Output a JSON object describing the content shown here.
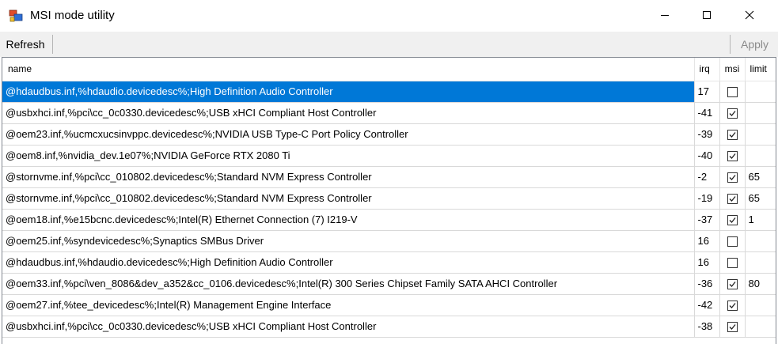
{
  "window": {
    "title": "MSI mode utility"
  },
  "toolbar": {
    "refresh_label": "Refresh",
    "apply_label": "Apply"
  },
  "table": {
    "columns": [
      "name",
      "irq",
      "msi",
      "limit"
    ],
    "rows": [
      {
        "name": "@hdaudbus.inf,%hdaudio.devicedesc%;High Definition Audio Controller",
        "irq": "17",
        "msi": false,
        "limit": ""
      },
      {
        "name": "@usbxhci.inf,%pci\\cc_0c0330.devicedesc%;USB xHCI Compliant Host Controller",
        "irq": "-41",
        "msi": true,
        "limit": ""
      },
      {
        "name": "@oem23.inf,%ucmcxucsinvppc.devicedesc%;NVIDIA USB Type-C Port Policy Controller",
        "irq": "-39",
        "msi": true,
        "limit": ""
      },
      {
        "name": "@oem8.inf,%nvidia_dev.1e07%;NVIDIA GeForce RTX 2080 Ti",
        "irq": "-40",
        "msi": true,
        "limit": ""
      },
      {
        "name": "@stornvme.inf,%pci\\cc_010802.devicedesc%;Standard NVM Express Controller",
        "irq": "-2",
        "msi": true,
        "limit": "65"
      },
      {
        "name": "@stornvme.inf,%pci\\cc_010802.devicedesc%;Standard NVM Express Controller",
        "irq": "-19",
        "msi": true,
        "limit": "65"
      },
      {
        "name": "@oem18.inf,%e15bcnc.devicedesc%;Intel(R) Ethernet Connection (7) I219-V",
        "irq": "-37",
        "msi": true,
        "limit": "1"
      },
      {
        "name": "@oem25.inf,%syndevicedesc%;Synaptics SMBus Driver",
        "irq": "16",
        "msi": false,
        "limit": ""
      },
      {
        "name": "@hdaudbus.inf,%hdaudio.devicedesc%;High Definition Audio Controller",
        "irq": "16",
        "msi": false,
        "limit": ""
      },
      {
        "name": "@oem33.inf,%pci\\ven_8086&dev_a352&cc_0106.devicedesc%;Intel(R) 300 Series Chipset Family SATA AHCI Controller",
        "irq": "-36",
        "msi": true,
        "limit": "80"
      },
      {
        "name": "@oem27.inf,%tee_devicedesc%;Intel(R) Management Engine Interface",
        "irq": "-42",
        "msi": true,
        "limit": ""
      },
      {
        "name": "@usbxhci.inf,%pci\\cc_0c0330.devicedesc%;USB xHCI Compliant Host Controller",
        "irq": "-38",
        "msi": true,
        "limit": ""
      }
    ]
  },
  "icons": {
    "app": "msi-utility-app-icon",
    "minimize": "minimize-icon",
    "maximize": "maximize-icon",
    "close": "close-icon",
    "checkbox": "checkmark-icon"
  },
  "colors": {
    "selection": "#0078d7",
    "toolbar_bg": "#f0f0f0",
    "apply_disabled": "#8a8a8a"
  }
}
